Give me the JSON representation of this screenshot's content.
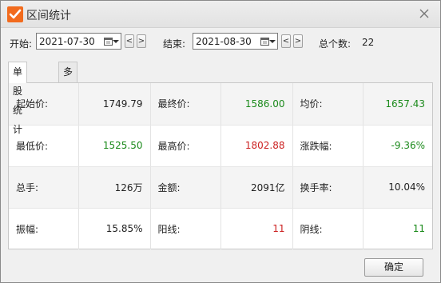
{
  "window": {
    "title": "区间统计"
  },
  "toolbar": {
    "start_label": "开始:",
    "start_date": "2021-07-30",
    "end_label": "结束:",
    "end_date": "2021-08-30",
    "prev_label": "<",
    "next_label": ">",
    "total_label": "总个数:",
    "total_value": "22"
  },
  "tabs": [
    {
      "label": "单股统计",
      "active": true
    },
    {
      "label": "多股比较",
      "active": false
    }
  ],
  "stats": {
    "rows": [
      [
        {
          "label": "起始价:",
          "value": "1749.79",
          "color": "#222222"
        },
        {
          "label": "最终价:",
          "value": "1586.00",
          "color": "#1b8a1b"
        },
        {
          "label": "均价:",
          "value": "1657.43",
          "color": "#1b8a1b"
        }
      ],
      [
        {
          "label": "最低价:",
          "value": "1525.50",
          "color": "#1b8a1b"
        },
        {
          "label": "最高价:",
          "value": "1802.88",
          "color": "#cc2222"
        },
        {
          "label": "涨跌幅:",
          "value": "-9.36%",
          "color": "#1b8a1b"
        }
      ],
      [
        {
          "label": "总手:",
          "value": "126万",
          "color": "#222222"
        },
        {
          "label": "金额:",
          "value": "2091亿",
          "color": "#222222"
        },
        {
          "label": "换手率:",
          "value": "10.04%",
          "color": "#222222"
        }
      ],
      [
        {
          "label": "振幅:",
          "value": "15.85%",
          "color": "#222222"
        },
        {
          "label": "阳线:",
          "value": "11",
          "color": "#cc2222"
        },
        {
          "label": "阴线:",
          "value": "11",
          "color": "#1b8a1b"
        }
      ]
    ]
  },
  "footer": {
    "ok_label": "确定"
  },
  "colors": {
    "accent": "#f26b1d",
    "up": "#cc2222",
    "down": "#1b8a1b"
  }
}
